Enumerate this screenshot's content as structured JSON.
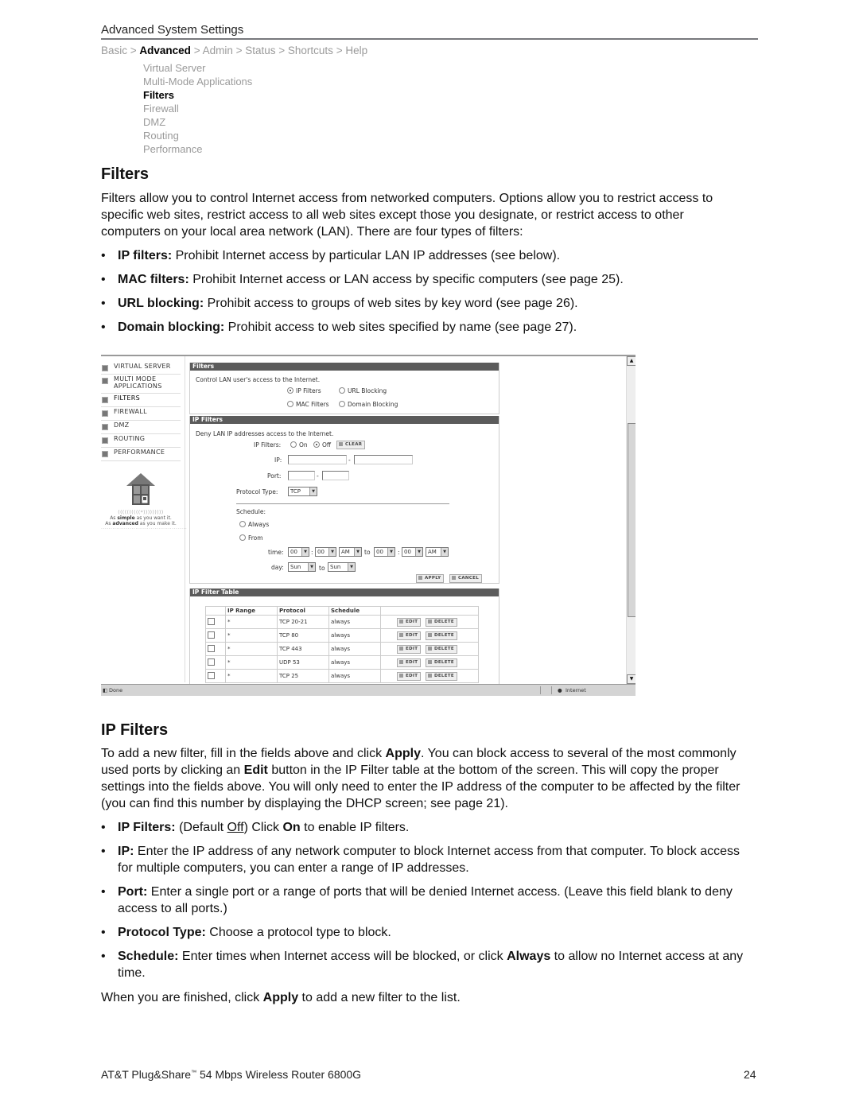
{
  "header": {
    "title": "Advanced System Settings",
    "breadcrumb": [
      {
        "label": "Basic",
        "current": false
      },
      {
        "label": "Advanced",
        "current": true
      },
      {
        "label": "Admin",
        "current": false
      },
      {
        "label": "Status",
        "current": false
      },
      {
        "label": "Shortcuts",
        "current": false
      },
      {
        "label": "Help",
        "current": false
      }
    ],
    "separator": ">",
    "subnav": [
      {
        "label": "Virtual Server",
        "current": false
      },
      {
        "label": "Multi-Mode Applications",
        "current": false
      },
      {
        "label": "Filters",
        "current": true
      },
      {
        "label": "Firewall",
        "current": false
      },
      {
        "label": "DMZ",
        "current": false
      },
      {
        "label": "Routing",
        "current": false
      },
      {
        "label": "Performance",
        "current": false
      }
    ]
  },
  "filters_section": {
    "heading": "Filters",
    "intro": "Filters allow you to control Internet access from networked computers. Options allow you to restrict access to specific web sites, restrict access to all web sites except those you designate, or restrict access to other computers on your local area network (LAN). There are four types of filters:",
    "bullets": [
      {
        "term": "IP filters:",
        "text": " Prohibit Internet access by particular LAN IP addresses (see below)."
      },
      {
        "term": "MAC filters:",
        "text": " Prohibit Internet access or LAN access by specific computers (see page 25)."
      },
      {
        "term": "URL blocking:",
        "text": " Prohibit access to groups of web sites by key word (see page 26)."
      },
      {
        "term": "Domain blocking:",
        "text": " Prohibit access to web sites specified by name (see page 27)."
      }
    ]
  },
  "screenshot": {
    "nav": [
      "VIRTUAL SERVER",
      "MULTI MODE APPLICATIONS",
      "FILTERS",
      "FIREWALL",
      "DMZ",
      "ROUTING",
      "PERFORMANCE"
    ],
    "logo": {
      "tm": "SM",
      "line1_pre": "As ",
      "line1_bold": "simple",
      "line1_post": " as you want it.",
      "line2_pre": "As ",
      "line2_bold": "advanced",
      "line2_post": " as you make it."
    },
    "filters_panel": {
      "title": "Filters",
      "description": "Control LAN user's access to the Internet.",
      "options": [
        {
          "label": "IP Filters",
          "selected": true
        },
        {
          "label": "URL Blocking",
          "selected": false
        },
        {
          "label": "MAC Filters",
          "selected": false
        },
        {
          "label": "Domain Blocking",
          "selected": false
        }
      ]
    },
    "ip_filters_panel": {
      "title": "IP Filters",
      "description": "Deny LAN IP addresses access to the Internet.",
      "ip_filters_label": "IP Filters:",
      "on_label": "On",
      "off_label": "Off",
      "state": "Off",
      "clear_label": "CLEAR",
      "ip_label": "IP:",
      "ip_from": "",
      "ip_to": "",
      "port_label": "Port:",
      "port_from": "",
      "port_to": "",
      "dash": "-",
      "protocol_label": "Protocol Type:",
      "protocol_value": "TCP",
      "schedule_label": "Schedule:",
      "always_label": "Always",
      "from_label": "From",
      "time_label": "time:",
      "time_from_hour": "00",
      "time_from_min": "00",
      "time_from_ampm": "AM",
      "to_label": "to",
      "time_to_hour": "00",
      "time_to_min": "00",
      "time_to_ampm": "AM",
      "colon": ":",
      "day_label": "day:",
      "day_from": "Sun",
      "day_to": "Sun",
      "apply_label": "APPLY",
      "cancel_label": "CANCEL"
    },
    "table_panel": {
      "title": "IP Filter Table",
      "columns": [
        "",
        "IP Range",
        "Protocol",
        "Schedule",
        ""
      ],
      "rows": [
        {
          "ip_range": "*",
          "protocol": "TCP 20-21",
          "schedule": "always"
        },
        {
          "ip_range": "*",
          "protocol": "TCP 80",
          "schedule": "always"
        },
        {
          "ip_range": "*",
          "protocol": "TCP 443",
          "schedule": "always"
        },
        {
          "ip_range": "*",
          "protocol": "UDP 53",
          "schedule": "always"
        },
        {
          "ip_range": "*",
          "protocol": "TCP 25",
          "schedule": "always"
        }
      ],
      "edit_label": "EDIT",
      "delete_label": "DELETE"
    },
    "status_bar": {
      "left": "Done",
      "zone": "Internet"
    }
  },
  "ip_filters_section": {
    "heading": "IP Filters",
    "intro_parts": [
      {
        "t": "To add a new filter, fill in the fields above and click ",
        "b": false
      },
      {
        "t": "Apply",
        "b": true
      },
      {
        "t": ". You can block access to several of the most commonly used ports by clicking an ",
        "b": false
      },
      {
        "t": "Edit",
        "b": true
      },
      {
        "t": " button in the IP Filter table at the bottom of the screen. This will copy the proper settings into the fields above. You will only need to enter the IP address of the computer to be affected by the filter (you can find this number by displaying the DHCP screen; see page 21).",
        "b": false
      }
    ],
    "bullets": [
      {
        "parts": [
          {
            "t": "IP Filters:",
            "b": true
          },
          {
            "t": " (Default ",
            "b": false
          },
          {
            "t": "Off",
            "u": true
          },
          {
            "t": ") Click ",
            "b": false
          },
          {
            "t": "On",
            "b": true
          },
          {
            "t": " to enable IP filters.",
            "b": false
          }
        ]
      },
      {
        "parts": [
          {
            "t": "IP:",
            "b": true
          },
          {
            "t": " Enter the IP address of any network computer to block Internet access from that computer. To block access for multiple computers, you can enter a range of IP addresses.",
            "b": false
          }
        ]
      },
      {
        "parts": [
          {
            "t": "Port:",
            "b": true
          },
          {
            "t": " Enter a single port or a range of ports that will be denied Internet access. (Leave this field blank to deny access to all ports.)",
            "b": false
          }
        ]
      },
      {
        "parts": [
          {
            "t": "Protocol Type:",
            "b": true
          },
          {
            "t": " Choose a protocol type to block.",
            "b": false
          }
        ]
      },
      {
        "parts": [
          {
            "t": "Schedule:",
            "b": true
          },
          {
            "t": " Enter times when Internet access will be blocked, or click ",
            "b": false
          },
          {
            "t": "Always",
            "b": true
          },
          {
            "t": " to allow no Internet access at any time.",
            "b": false
          }
        ]
      }
    ],
    "closing_parts": [
      {
        "t": "When you are finished, click ",
        "b": false
      },
      {
        "t": "Apply",
        "b": true
      },
      {
        "t": " to add a new filter to the list.",
        "b": false
      }
    ]
  },
  "footer": {
    "product_pre": "AT&T Plug&Share",
    "tm": "™",
    "product_post": " 54 Mbps Wireless Router 6800G",
    "page_number": "24"
  }
}
